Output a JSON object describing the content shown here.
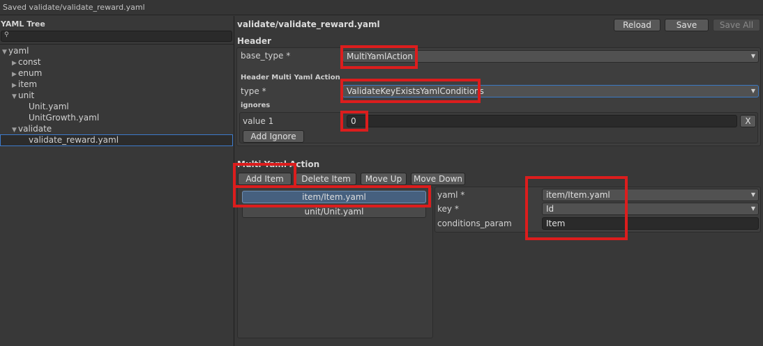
{
  "status": {
    "text": "Saved validate/validate_reward.yaml"
  },
  "tree": {
    "title": "YAML Tree",
    "search_icon": "search-icon",
    "items": [
      {
        "label": "yaml",
        "arrow": "▼"
      },
      {
        "label": "const",
        "arrow": "▶"
      },
      {
        "label": "enum",
        "arrow": "▶"
      },
      {
        "label": "item",
        "arrow": "▶"
      },
      {
        "label": "unit",
        "arrow": "▼"
      },
      {
        "label": "Unit.yaml",
        "arrow": ""
      },
      {
        "label": "UnitGrowth.yaml",
        "arrow": ""
      },
      {
        "label": "validate",
        "arrow": "▼"
      },
      {
        "label": "validate_reward.yaml",
        "arrow": ""
      }
    ]
  },
  "editor": {
    "file_path": "validate/validate_reward.yaml",
    "toolbar": {
      "reload": "Reload",
      "save": "Save",
      "save_all": "Save All"
    },
    "header": {
      "title": "Header",
      "base_type_label": "base_type *",
      "base_type_value": "MultiYamlAction",
      "subheader": "Header Multi Yaml Action",
      "type_label": "type *",
      "type_value": "ValidateKeyExistsYamlConditions",
      "ignores_label": "ignores",
      "value1_label": "value 1",
      "value1_value": "0",
      "remove_label": "X",
      "add_ignore": "Add Ignore"
    },
    "multi": {
      "title": "Multi Yaml Action",
      "buttons": {
        "add_item": "Add Item",
        "delete_item": "Delete Item",
        "move_up": "Move Up",
        "move_down": "Move Down"
      },
      "list": [
        "item/Item.yaml",
        "unit/Unit.yaml"
      ],
      "detail": {
        "yaml_label": "yaml *",
        "yaml_value": "item/Item.yaml",
        "key_label": "key *",
        "key_value": "Id",
        "conditions_label": "conditions_param",
        "conditions_value": "Item"
      }
    }
  },
  "colors": {
    "highlight": "#dc1d1d",
    "selection": "#46607f",
    "focus": "#3a79c4"
  }
}
